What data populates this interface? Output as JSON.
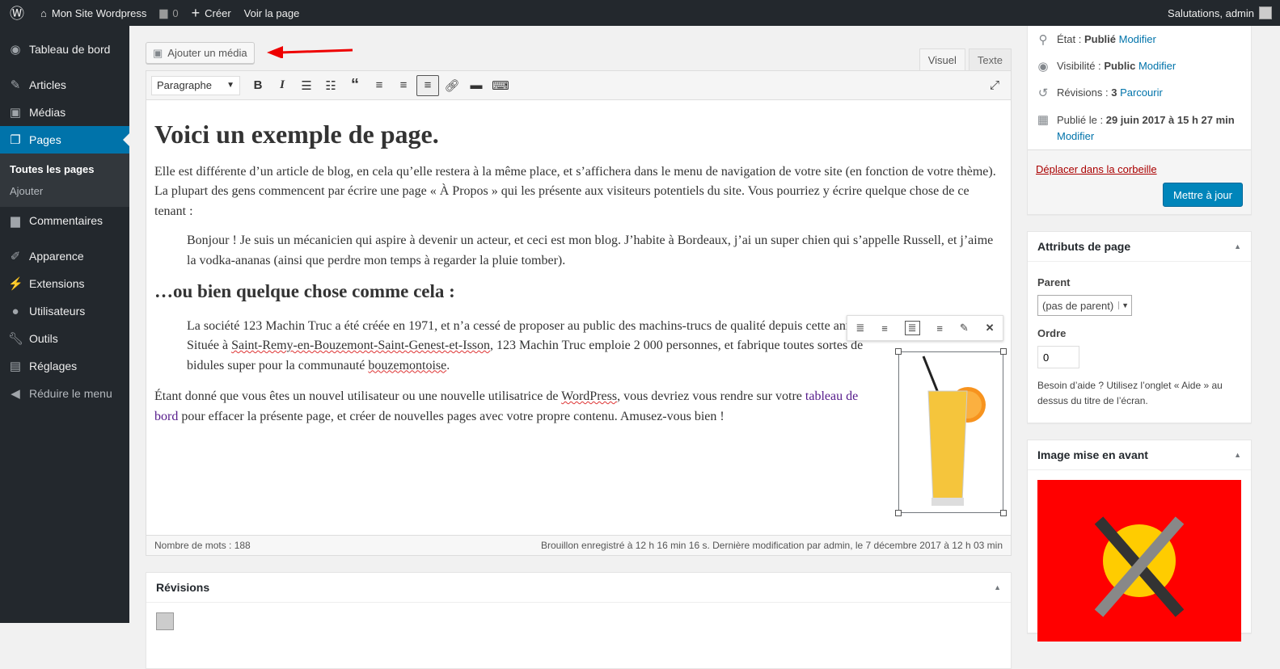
{
  "adminbar": {
    "site": "Mon Site Wordpress",
    "comments": "0",
    "create": "Créer",
    "view": "Voir la page",
    "greeting": "Salutations, admin"
  },
  "sidebar": {
    "items": [
      {
        "label": "Tableau de bord",
        "icon": "dashboard-icon"
      },
      {
        "label": "Articles",
        "icon": "pin-icon"
      },
      {
        "label": "Médias",
        "icon": "media-icon"
      },
      {
        "label": "Pages",
        "icon": "pages-icon"
      },
      {
        "label": "Commentaires",
        "icon": "comment-icon"
      },
      {
        "label": "Apparence",
        "icon": "brush-icon"
      },
      {
        "label": "Extensions",
        "icon": "plugin-icon"
      },
      {
        "label": "Utilisateurs",
        "icon": "user-icon"
      },
      {
        "label": "Outils",
        "icon": "wrench-icon"
      },
      {
        "label": "Réglages",
        "icon": "settings-icon"
      },
      {
        "label": "Réduire le menu",
        "icon": "collapse-icon"
      }
    ],
    "sub": [
      "Toutes les pages",
      "Ajouter"
    ]
  },
  "editor": {
    "add_media": "Ajouter un média",
    "tabs": [
      "Visuel",
      "Texte"
    ],
    "format": "Paragraphe",
    "h1": "Voici un exemple de page.",
    "p1": "Elle est différente d’un article de blog, en cela qu’elle restera à la même place, et s’affichera dans le menu de navigation de votre site (en fonction de votre thème). La plupart des gens commencent par écrire une page « À Propos » qui les présente aux visiteurs potentiels du site. Vous pourriez y écrire quelque chose de ce tenant :",
    "q1": "Bonjour ! Je suis un mécanicien qui aspire à devenir un acteur, et ceci est mon blog. J’habite à Bordeaux, j’ai un super chien qui s’appelle Russell, et j’aime la vodka-ananas (ainsi que perdre mon temps à regarder la pluie tomber).",
    "h2": "…ou bien quelque chose comme cela :",
    "q2a": "La société 123 Machin Truc a été créée en 1971, et n’a cessé de proposer au public des machins-trucs de qualité depuis cette année. Située à ",
    "q2b": "Saint-Remy-en-Bouzemont-Saint-Genest-et-Isson",
    "q2c": ", 123 Machin Truc emploie 2 000 personnes, et fabrique toutes sortes de bidules super pour la communauté ",
    "q2d": "bouzemontoise",
    "q2e": ".",
    "p2a": "Étant donné que vous êtes un nouvel utilisateur ou une nouvelle utilisatrice de ",
    "p2b": "WordPress",
    "p2c": ", vous devriez vous rendre sur votre ",
    "p2link": "tableau de bord",
    "p2d": " pour effacer la présente page, et créer de nouvelles pages avec votre propre contenu. Amusez-vous bien !",
    "word_count": "Nombre de mots : 188",
    "saved": "Brouillon enregistré à 12 h 16 min 16 s. Dernière modification par admin, le 7 décembre 2017 à 12 h 03 min"
  },
  "revisions": {
    "title": "Révisions"
  },
  "publish": {
    "state_label": "État :",
    "state": "Publié",
    "visibility_label": "Visibilité :",
    "visibility": "Public",
    "revisions_label": "Révisions :",
    "revisions": "3",
    "browse": "Parcourir",
    "published_label": "Publié le :",
    "published": "29 juin 2017 à 15 h 27 min",
    "modify": "Modifier",
    "trash": "Déplacer dans la corbeille",
    "update": "Mettre à jour"
  },
  "attributes": {
    "title": "Attributs de page",
    "parent_label": "Parent",
    "parent": "(pas de parent)",
    "order_label": "Ordre",
    "order": "0",
    "help": "Besoin d’aide ? Utilisez l’onglet « Aide » au dessus du titre de l’écran."
  },
  "featured": {
    "title": "Image mise en avant"
  },
  "colors": {
    "accent": "#0073aa",
    "sidebar": "#23282d",
    "trash": "#a00"
  }
}
